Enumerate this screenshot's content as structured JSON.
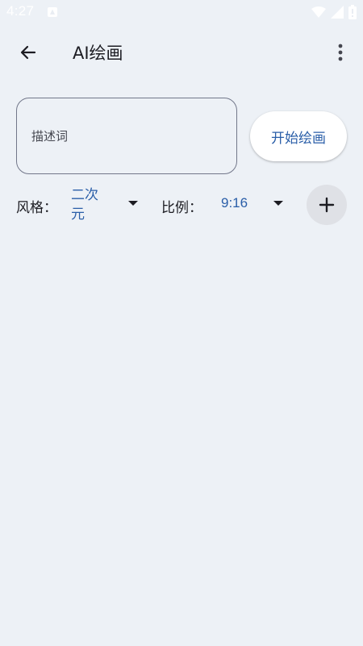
{
  "status_bar": {
    "time": "4:27"
  },
  "app_bar": {
    "title": "AI绘画",
    "back_icon": "arrow-left-icon",
    "more_icon": "more-vert-icon"
  },
  "prompt": {
    "placeholder": "描述词",
    "value": ""
  },
  "start_button": {
    "label": "开始绘画"
  },
  "options": {
    "style_label": "风格：",
    "style_value": "二次元",
    "ratio_label": "比例：",
    "ratio_value": "9:16"
  },
  "add_button": {
    "icon": "plus-icon"
  },
  "colors": {
    "background": "#edf1f6",
    "accent": "#2a5ea8",
    "outline": "#72778a"
  }
}
